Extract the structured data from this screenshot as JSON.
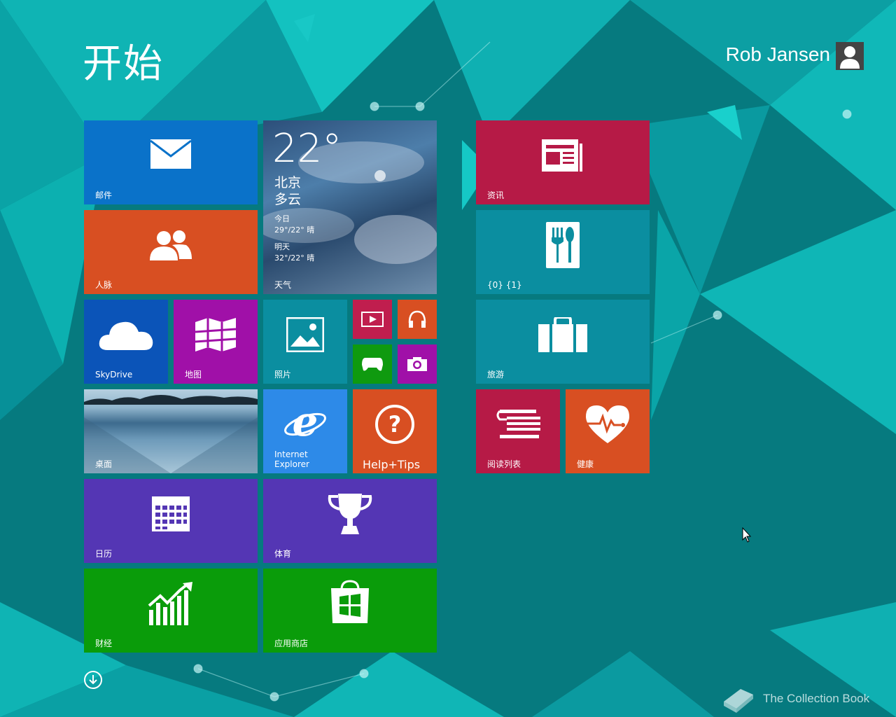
{
  "screen": {
    "title": "开始",
    "user": {
      "name": "Rob Jansen"
    }
  },
  "tiles": {
    "mail": {
      "label": "邮件",
      "color": "#0a72c9",
      "icon": "mail-icon"
    },
    "people": {
      "label": "人脉",
      "color": "#d84f22",
      "icon": "people-icon"
    },
    "weather": {
      "label": "天气",
      "temp": "22°",
      "city": "北京",
      "condition": "多云",
      "today_label": "今日",
      "today_forecast": "29°/22° 晴",
      "tomorrow_label": "明天",
      "tomorrow_forecast": "32°/22° 晴"
    },
    "skydrive": {
      "label": "SkyDrive",
      "color": "#0b54b8",
      "icon": "cloud-icon"
    },
    "maps": {
      "label": "地图",
      "color": "#a010a8",
      "icon": "map-icon"
    },
    "photos": {
      "label": "照片",
      "color": "#0b8ea0",
      "icon": "photo-icon"
    },
    "video": {
      "color": "#c01e4e",
      "icon": "video-icon"
    },
    "music": {
      "color": "#d84f22",
      "icon": "headphones-icon"
    },
    "games": {
      "color": "#0f9a0f",
      "icon": "gamepad-icon"
    },
    "camera": {
      "color": "#a010a8",
      "icon": "camera-icon"
    },
    "desktop": {
      "label": "桌面"
    },
    "ie": {
      "label_line1": "Internet",
      "label_line2": "Explorer",
      "color": "#2d8ae8",
      "icon": "internet-explorer-icon"
    },
    "help": {
      "label": "Help+Tips",
      "color": "#d84f22",
      "icon": "help-icon"
    },
    "calendar": {
      "label": "日历",
      "color": "#5436b4",
      "icon": "calendar-icon"
    },
    "sports": {
      "label": "体育",
      "color": "#5436b4",
      "icon": "trophy-icon"
    },
    "finance": {
      "label": "财经",
      "color": "#0a9c0a",
      "icon": "chart-up-icon"
    },
    "store": {
      "label": "应用商店",
      "color": "#0a9c0a",
      "icon": "store-bag-icon"
    },
    "news": {
      "label": "资讯",
      "color": "#b61a46",
      "icon": "newspaper-icon"
    },
    "food": {
      "label": "{0} {1}",
      "color": "#0b8ea0",
      "icon": "fork-spoon-icon"
    },
    "travel": {
      "label": "旅游",
      "color": "#0b8ea0",
      "icon": "suitcase-icon"
    },
    "reading": {
      "label": "阅读列表",
      "color": "#b61a46",
      "icon": "reading-list-icon"
    },
    "health": {
      "label": "健康",
      "color": "#d84f22",
      "icon": "heart-pulse-icon"
    }
  },
  "footer": {
    "all_apps_icon": "arrow-down-circle-icon",
    "watermark": "The Collection Book"
  }
}
